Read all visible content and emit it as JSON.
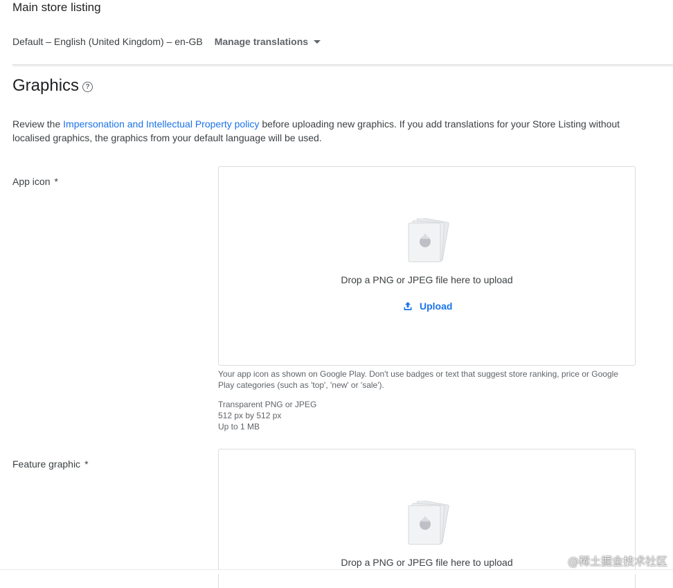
{
  "header": {
    "title": "Main store listing",
    "language": "Default – English (United Kingdom) – en-GB",
    "manage_translations": "Manage translations"
  },
  "graphics": {
    "title": "Graphics",
    "help_icon": "help-circle-icon",
    "policy_prefix": "Review the ",
    "policy_link": "Impersonation and Intellectual Property policy",
    "policy_suffix": " before uploading new graphics. If you add translations for your Store Listing without localised graphics, the graphics from your default language will be used."
  },
  "app_icon": {
    "label": "App icon",
    "required": "*",
    "drop_text": "Drop a PNG or JPEG file here to upload",
    "upload_label": "Upload",
    "description": "Your app icon as shown on Google Play. Don't use badges or text that suggest store ranking, price or Google Play categories (such as 'top', 'new' or 'sale').",
    "spec_format": "Transparent PNG or JPEG",
    "spec_size": "512 px by 512 px",
    "spec_max": "Up to 1 MB"
  },
  "feature_graphic": {
    "label": "Feature graphic",
    "required": "*",
    "drop_text": "Drop a PNG or JPEG file here to upload"
  },
  "watermark": "@稀土掘金技术社区",
  "colors": {
    "link": "#1a73e8",
    "text": "#3c4043",
    "border": "#dadce0"
  }
}
